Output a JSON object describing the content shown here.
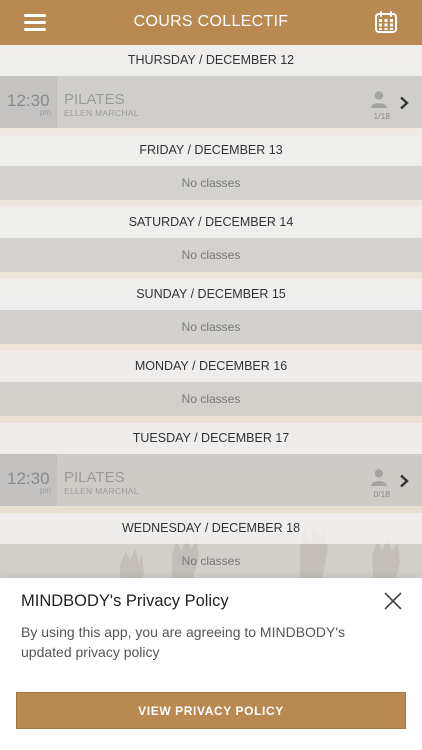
{
  "header": {
    "title": "COURS COLLECTIF",
    "menu_icon": "hamburger-menu-icon",
    "calendar_icon": "calendar-icon",
    "background_color": "#b88951"
  },
  "schedule": [
    {
      "day": "THURSDAY / DECEMBER 12",
      "classes": [
        {
          "time": "12:30",
          "ampm": "pm",
          "name": "PILATES",
          "teacher": "ELLEN MARCHAL",
          "capacity": "1/18"
        }
      ]
    },
    {
      "day": "FRIDAY / DECEMBER 13",
      "empty_text": "No classes"
    },
    {
      "day": "SATURDAY / DECEMBER 14",
      "empty_text": "No classes"
    },
    {
      "day": "SUNDAY / DECEMBER 15",
      "empty_text": "No classes"
    },
    {
      "day": "MONDAY / DECEMBER 16",
      "empty_text": "No classes"
    },
    {
      "day": "TUESDAY / DECEMBER 17",
      "classes": [
        {
          "time": "12:30",
          "ampm": "pm",
          "name": "PILATES",
          "teacher": "ELLEN MARCHAL",
          "capacity": "0/18"
        }
      ]
    },
    {
      "day": "WEDNESDAY / DECEMBER 18",
      "empty_text": "No classes"
    }
  ],
  "privacy_modal": {
    "title": "MINDBODY's Privacy Policy",
    "body": "By using this app, you are agreeing to MINDBODY's updated privacy policy",
    "button_label": "VIEW PRIVACY POLICY",
    "close_icon": "close-icon",
    "button_color": "#b88951"
  }
}
